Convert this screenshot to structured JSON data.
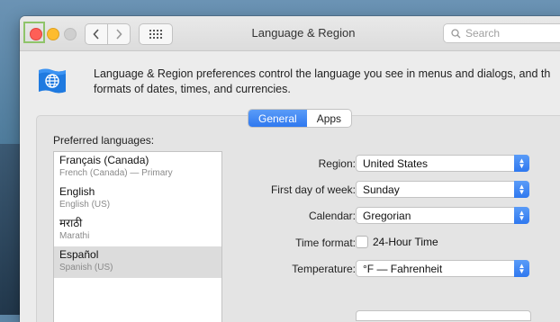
{
  "window": {
    "title": "Language & Region"
  },
  "search": {
    "placeholder": "Search"
  },
  "intro": {
    "line1": "Language & Region preferences control the language you see in menus and dialogs, and th",
    "line2": "formats of dates, times, and currencies."
  },
  "tabs": [
    {
      "label": "General",
      "active": true
    },
    {
      "label": "Apps",
      "active": false
    }
  ],
  "preferred": {
    "label": "Preferred languages:",
    "items": [
      {
        "name": "Français (Canada)",
        "sub": "French (Canada) — Primary"
      },
      {
        "name": "English",
        "sub": "English (US)"
      },
      {
        "name": "मराठी",
        "sub": "Marathi"
      },
      {
        "name": "Español",
        "sub": "Spanish (US)"
      }
    ]
  },
  "settings": {
    "region_label": "Region:",
    "region_value": "United States",
    "first_day_label": "First day of week:",
    "first_day_value": "Sunday",
    "calendar_label": "Calendar:",
    "calendar_value": "Gregorian",
    "time_format_label": "Time format:",
    "time_format_value": "24-Hour Time",
    "temperature_label": "Temperature:",
    "temperature_value": "°F — Fahrenheit"
  },
  "colors": {
    "accent": "#2f78ef",
    "close": "#fe5f57",
    "minimize": "#febc2e"
  },
  "icons": {
    "back": "chevron-left-icon",
    "forward": "chevron-right-icon",
    "grid": "grid-icon",
    "search": "search-icon",
    "header": "flag-globe-icon"
  }
}
